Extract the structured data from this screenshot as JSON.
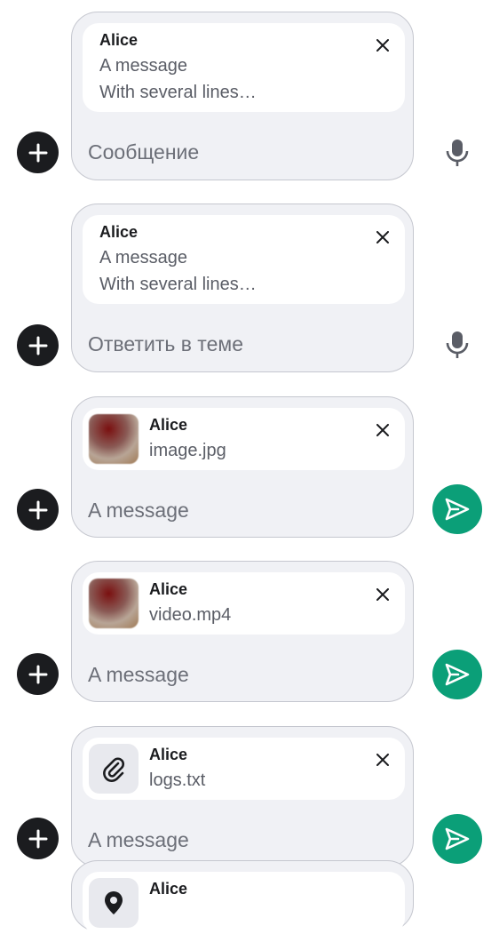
{
  "composers": [
    {
      "reply": {
        "sender": "Alice",
        "lines": [
          "A message",
          "With several lines…"
        ]
      },
      "placeholder": "Сообщение",
      "action": "mic"
    },
    {
      "reply": {
        "sender": "Alice",
        "lines": [
          "A message",
          "With several lines…"
        ]
      },
      "placeholder": "Ответить в теме",
      "action": "mic"
    },
    {
      "reply": {
        "sender": "Alice",
        "file": "image.jpg",
        "thumb": "image"
      },
      "placeholder": "A message",
      "action": "send"
    },
    {
      "reply": {
        "sender": "Alice",
        "file": "video.mp4",
        "thumb": "video"
      },
      "placeholder": "A message",
      "action": "send"
    },
    {
      "reply": {
        "sender": "Alice",
        "file": "logs.txt",
        "thumb": "paperclip-icon"
      },
      "placeholder": "A message",
      "action": "send"
    },
    {
      "reply": {
        "sender": "Alice",
        "thumb": "location-pin-icon"
      }
    }
  ],
  "colors": {
    "send": "#0b9f78",
    "add": "#1b1c1f",
    "composer_bg": "#f0f1f5"
  },
  "icons": {
    "add": "plus-icon",
    "close": "close-icon",
    "mic": "microphone-icon",
    "send": "send-icon"
  }
}
